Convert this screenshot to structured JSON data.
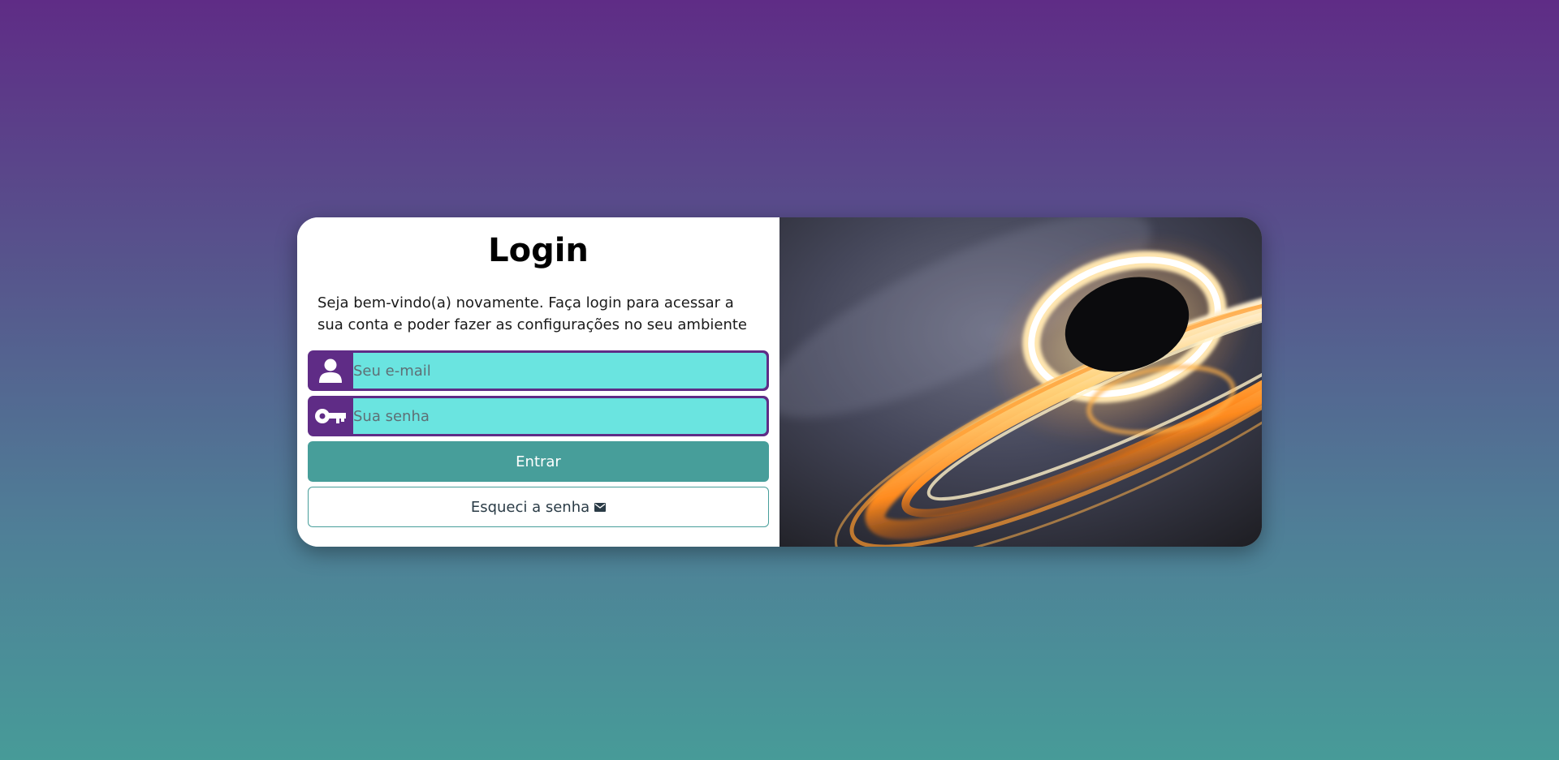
{
  "login": {
    "title": "Login",
    "welcome_text": "Seja bem-vindo(a) novamente. Faça login para acessar a sua conta e poder fazer as configurações no seu ambiente",
    "email": {
      "placeholder": "Seu e-mail",
      "value": "",
      "icon": "user-icon"
    },
    "password": {
      "placeholder": "Sua senha",
      "value": "",
      "icon": "key-icon"
    },
    "submit_label": "Entrar",
    "forgot_label": "Esqueci a senha",
    "forgot_icon": "envelope-icon"
  },
  "hero_image": {
    "subject": "black-hole"
  },
  "colors": {
    "brand_purple": "#5f2c86",
    "input_cyan": "#6ae4e0",
    "button_teal": "#479e9a",
    "background_top": "#5f2c86",
    "background_bottom": "#479b98"
  }
}
